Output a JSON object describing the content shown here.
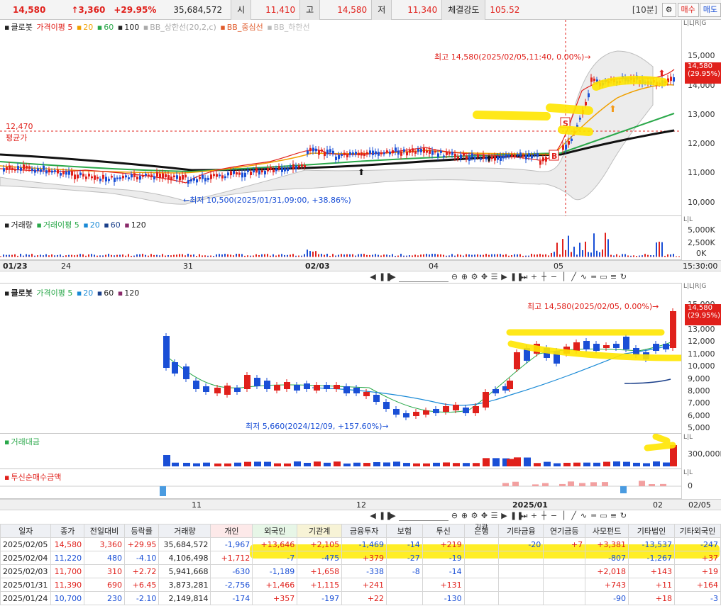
{
  "header": {
    "price": "14,580",
    "change": "↑3,360",
    "change_rate": "+29.95%",
    "volume": "35,684,572",
    "open_label": "시",
    "open_value": "11,410",
    "high_label": "고",
    "high_value": "14,580",
    "low_label": "저",
    "low_value": "11,340",
    "strength_label": "체결강도",
    "strength_value": "105.52",
    "interval": "[10분]",
    "buy_button": "매수",
    "sell_button": "매도"
  },
  "top_chart": {
    "legend_name": "클로봇",
    "legend_ma": "가격이평 5",
    "legend_20": "20",
    "legend_60": "60",
    "legend_100": "100",
    "legend_bb_upper": "BB_상한선(20,2,c)",
    "legend_bb_mid": "BB_중심선",
    "legend_bb_lower": "BB_하한선",
    "high_annotation": "최고 14,580(2025/02/05,11:40, 0.00%)→",
    "low_annotation": "←최저 10,500(2025/01/31,09:00, +38.86%)",
    "avg_price_value": "12,470",
    "avg_price_label": "평균가",
    "price_tag": "14,580",
    "price_tag_rate": "(29.95%)",
    "axis_flags": "L|L|R|G",
    "y_ticks": [
      "15,000",
      "14,000",
      "13,000",
      "12,000",
      "11,000",
      "10,000"
    ],
    "marker_s": "S",
    "marker_b": "B"
  },
  "top_volume": {
    "legend_name": "거래량",
    "legend_ma": "거래이평 5",
    "legend_20": "20",
    "legend_60": "60",
    "legend_120": "120",
    "y_ticks": [
      "5,000K",
      "2,500K",
      "0K"
    ],
    "axis_flags": "L|L"
  },
  "top_timeline": {
    "dates": [
      "01/23",
      "24",
      "31",
      "02/03",
      "04",
      "05"
    ],
    "time": "15:30:00"
  },
  "bottom_chart": {
    "legend_name": "클로봇",
    "legend_ma": "가격이평 5",
    "legend_20": "20",
    "legend_60": "60",
    "legend_120": "120",
    "high_annotation": "최고 14,580(2025/02/05, 0.00%)→",
    "low_annotation": "최저 5,660(2024/12/09, +157.60%)→",
    "price_tag": "14,580",
    "price_tag_rate": "(29.95%)",
    "axis_flags": "L|L|R|G",
    "y_ticks": [
      "15,000",
      "13,000",
      "12,000",
      "11,000",
      "10,000",
      "9,000",
      "8,000",
      "7,000",
      "6,000",
      "5,000"
    ]
  },
  "trade_value_panel": {
    "legend": "거래대금",
    "y_tick": "300,000M",
    "axis_flags": "L|L"
  },
  "trust_panel": {
    "legend": "투신순매수금액",
    "y_tick": "0",
    "axis_flags": "L|L"
  },
  "bottom_timeline": {
    "dates": [
      "11",
      "12",
      "2025/01",
      "02"
    ],
    "end_date": "02/05"
  },
  "table": {
    "columns": [
      "일자",
      "종가",
      "전일대비",
      "등락률",
      "거래량",
      "개인",
      "외국인",
      "기관계",
      "금융투자",
      "보험",
      "투신",
      "은행",
      "기타금융",
      "연기금등",
      "사모펀드",
      "기타법인",
      "기타외국인"
    ],
    "group_label": "기관",
    "rows": [
      [
        "2025/02/05",
        "14,580",
        "3,360",
        "+29.95",
        "35,684,572",
        "-1,967",
        "+13,646",
        "+2,105",
        "-1,469",
        "-14",
        "+219",
        "",
        "-20",
        "+7",
        "+3,381",
        "-13,537",
        "-247"
      ],
      [
        "2025/02/04",
        "11,220",
        "480",
        "-4.10",
        "4,106,498",
        "+1,712",
        "-7",
        "-475",
        "+379",
        "-27",
        "-19",
        "",
        "",
        "",
        "-807",
        "-1,267",
        "+37"
      ],
      [
        "2025/02/03",
        "11,700",
        "310",
        "+2.72",
        "5,941,668",
        "-630",
        "-1,189",
        "+1,658",
        "-338",
        "-8",
        "-14",
        "",
        "",
        "",
        "+2,018",
        "+143",
        "+19"
      ],
      [
        "2025/01/31",
        "11,390",
        "690",
        "+6.45",
        "3,873,281",
        "-2,756",
        "+1,466",
        "+1,115",
        "+241",
        "",
        "+131",
        "",
        "",
        "",
        "+743",
        "+11",
        "+164"
      ],
      [
        "2025/01/24",
        "10,700",
        "230",
        "-2.10",
        "2,149,814",
        "-174",
        "+357",
        "-197",
        "+22",
        "",
        "-130",
        "",
        "",
        "",
        "-90",
        "+18",
        "-3"
      ]
    ]
  },
  "colors": {
    "up": "#e0201b",
    "down": "#1a4fd6",
    "ma5": "#e05a2a",
    "ma20": "#f0a000",
    "ma60": "#2aa84a",
    "ma100": "#111111",
    "bb": "#d8d8d8",
    "highlight": "#ffe600"
  }
}
